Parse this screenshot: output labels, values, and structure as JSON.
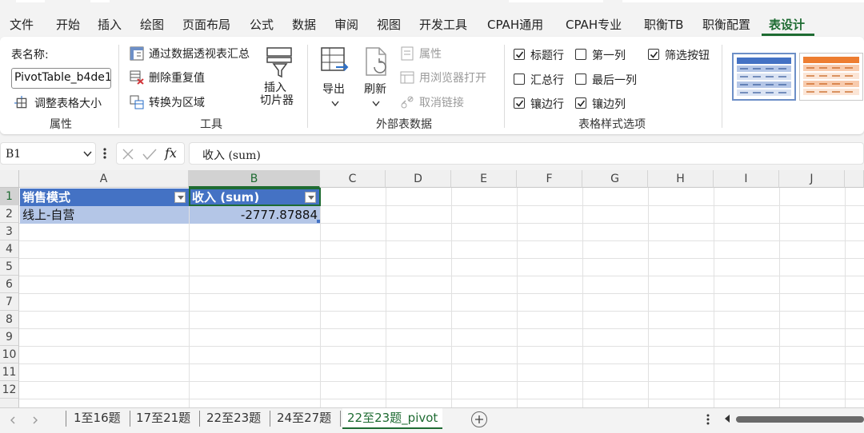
{
  "menu": {
    "tabs": [
      "文件",
      "开始",
      "插入",
      "绘图",
      "页面布局",
      "公式",
      "数据",
      "审阅",
      "视图",
      "开发工具",
      "CPAH通用",
      "CPAH专业",
      "职衡TB",
      "职衡配置",
      "表设计"
    ],
    "active_tab": "表设计"
  },
  "ribbon": {
    "properties": {
      "table_name_label": "表名称:",
      "table_name_value": "PivotTable_b4de1",
      "resize_table": "调整表格大小",
      "group_label": "属性"
    },
    "tools": {
      "summarize_pivot": "通过数据透视表汇总",
      "remove_duplicates": "删除重复值",
      "convert_to_range": "转换为区域",
      "insert_slicer": "插入\n切片器",
      "group_label": "工具"
    },
    "external": {
      "export": "导出",
      "refresh": "刷新",
      "properties": "属性",
      "open_in_browser": "用浏览器打开",
      "unlink": "取消链接",
      "group_label": "外部表数据"
    },
    "style_options": {
      "header_row": "标题行",
      "first_column": "第一列",
      "filter_button": "筛选按钮",
      "total_row": "汇总行",
      "last_column": "最后一列",
      "banded_rows": "镶边行",
      "banded_columns": "镶边列",
      "group_label": "表格样式选项",
      "checked": {
        "header_row": true,
        "first_column": false,
        "filter_button": true,
        "total_row": false,
        "last_column": false,
        "banded_rows": true,
        "banded_columns": true
      }
    }
  },
  "formula_bar": {
    "cell_ref": "B1",
    "formula": "收入 (sum)"
  },
  "grid": {
    "columns": [
      "A",
      "B",
      "C",
      "D",
      "E",
      "F",
      "G",
      "H",
      "I",
      "J"
    ],
    "rows": [
      "1",
      "2",
      "3",
      "4",
      "5",
      "6",
      "7",
      "8",
      "9",
      "10",
      "11",
      "12"
    ],
    "headers": {
      "a1": "销售模式",
      "b1": "收入 (sum)"
    },
    "data": {
      "a2": "线上-自营",
      "b2": "-2777.87884"
    }
  },
  "sheets": {
    "tabs": [
      "1至16题",
      "17至21题",
      "22至23题",
      "24至27题",
      "22至23题_pivot"
    ],
    "active": "22至23题_pivot"
  },
  "colors": {
    "accent": "#1e6b32",
    "header_fill": "#4472c4",
    "band_fill": "#b4c6e7"
  }
}
